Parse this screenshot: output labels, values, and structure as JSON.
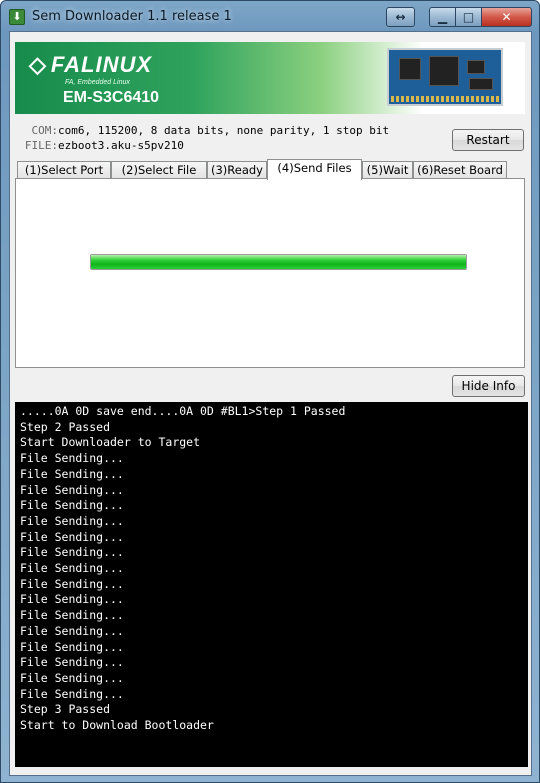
{
  "window": {
    "title": "Sem Downloader 1.1 release 1",
    "icon": "download-icon"
  },
  "banner": {
    "logo_text": "FALINUX",
    "tagline": "FA, Embedded Linux",
    "model": "EM-S3C6410",
    "image": "board-image"
  },
  "info": {
    "com_label": "COM:",
    "com_value": "com6, 115200, 8 data bits, none parity, 1 stop bit",
    "file_label": "FILE:",
    "file_value": "ezboot3.aku-s5pv210"
  },
  "buttons": {
    "restart": "Restart",
    "hide_info": "Hide Info"
  },
  "tabs": [
    {
      "label": "(1)Select Port"
    },
    {
      "label": "(2)Select File"
    },
    {
      "label": "(3)Ready"
    },
    {
      "label": "(4)Send Files",
      "active": true
    },
    {
      "label": "(5)Wait"
    },
    {
      "label": "(6)Reset Board"
    }
  ],
  "progress": {
    "value": 1.0
  },
  "console": {
    "lines": [
      ".....0A 0D save end....0A 0D #BL1>Step 1 Passed",
      "Step 2 Passed",
      "Start Downloader to Target",
      "File Sending...",
      "File Sending...",
      "File Sending...",
      "File Sending...",
      "File Sending...",
      "File Sending...",
      "File Sending...",
      "File Sending...",
      "File Sending...",
      "File Sending...",
      "File Sending...",
      "File Sending...",
      "File Sending...",
      "File Sending...",
      "File Sending...",
      "File Sending...",
      "Step 3 Passed",
      "Start to Download Bootloader"
    ]
  },
  "colors": {
    "progress": "#10b51c",
    "console_bg": "#000000",
    "banner": "#178b4b"
  }
}
